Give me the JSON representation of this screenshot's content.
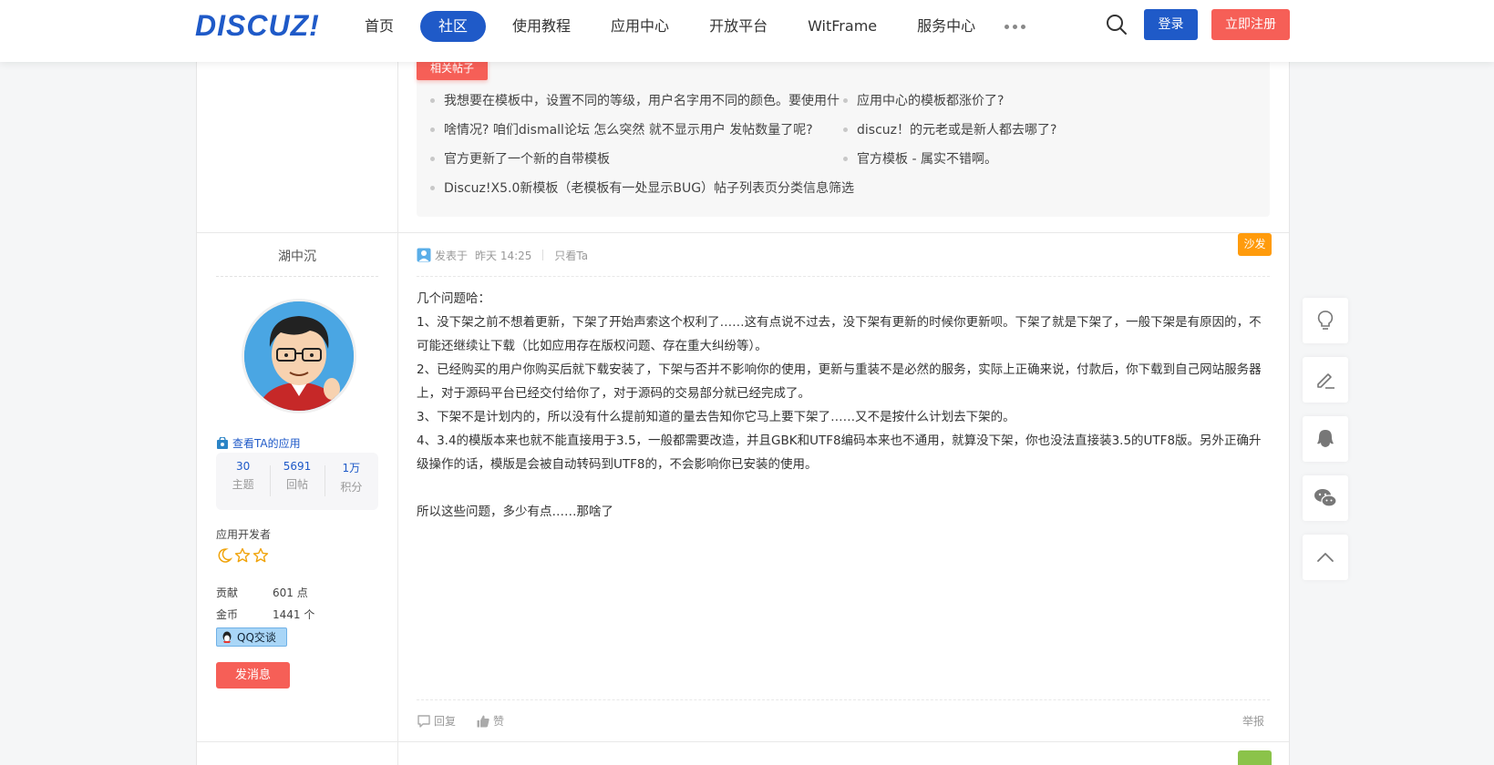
{
  "header": {
    "logo": "DISCUZ!",
    "nav": [
      "首页",
      "社区",
      "使用教程",
      "应用中心",
      "开放平台",
      "WitFrame",
      "服务中心"
    ],
    "active_index": 1,
    "login": "登录",
    "register": "立即注册"
  },
  "related": {
    "tag": "相关帖子",
    "items": [
      "我想要在模板中，设置不同的等级，用户名字用不同的颜色。要使用什",
      "应用中心的模板都涨价了?",
      "啥情况? 咱们dismall论坛 怎么突然 就不显示用户 发帖数量了呢?",
      "discuz！的元老或是新人都去哪了?",
      "官方更新了一个新的自带模板",
      "官方模板 - 属实不错啊。",
      "Discuz!X5.0新模板（老模板有一处显示BUG）帖子列表页分类信息筛选"
    ]
  },
  "author": {
    "name": "湖中沉",
    "view_apps": "查看TA的应用",
    "stats": [
      {
        "num": "30",
        "label": "主题"
      },
      {
        "num": "5691",
        "label": "回帖"
      },
      {
        "num": "1万",
        "label": "积分"
      }
    ],
    "rank": "应用开发者",
    "contrib_label": "贡献",
    "contrib_value": "601 点",
    "coins_label": "金币",
    "coins_value": "1441 个",
    "qq": "QQ交谈",
    "message": "发消息"
  },
  "post": {
    "posted_label": "发表于",
    "time": "昨天 14:25",
    "only_author": "只看Ta",
    "floor": "沙发",
    "paragraphs": [
      "几个问题哈：",
      "1、没下架之前不想着更新，下架了开始声索这个权利了……这有点说不过去，没下架有更新的时候你更新呗。下架了就是下架了，一般下架是有原因的，不可能还继续让下载（比如应用存在版权问题、存在重大纠纷等）。",
      "2、已经购买的用户你购买后就下载安装了，下架与否并不影响你的使用，更新与重装不是必然的服务，实际上正确来说，付款后，你下载到自己网站服务器上，对于源码平台已经交付给你了，对于源码的交易部分就已经完成了。",
      "3、下架不是计划内的，所以没有什么提前知道的量去告知你它马上要下架了……又不是按什么计划去下架的。",
      "4、3.4的模版本来也就不能直接用于3.5，一般都需要改造，并且GBK和UTF8编码本来也不通用，就算没下架，你也没法直接装3.5的UTF8版。另外正确升级操作的话，模版是会被自动转码到UTF8的，不会影响你已安装的使用。",
      "",
      "所以这些问题，多少有点……那啥了"
    ],
    "reply": "回复",
    "like": "赞",
    "report": "举报"
  },
  "colors": {
    "brand": "#1f5ac8",
    "accent": "#f65f57",
    "floor": "#ff9b0c"
  }
}
